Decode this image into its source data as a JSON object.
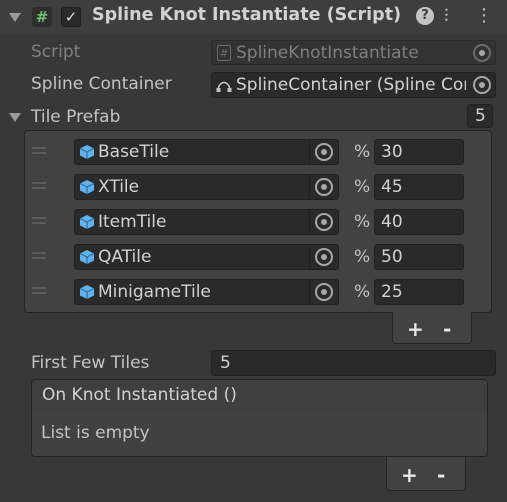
{
  "header": {
    "title": "Spline Knot Instantiate (Script)",
    "script_icon_glyph": "#",
    "enabled_glyph": "✓",
    "help_glyph": "?",
    "settings_glyph": "⫶",
    "menu_glyph": "⋮"
  },
  "script_row": {
    "label": "Script",
    "value": "SplineKnotInstantiate"
  },
  "container_row": {
    "label": "Spline Container",
    "value": "SplineContainer (Spline Con"
  },
  "tile_prefab": {
    "label": "Tile Prefab",
    "size": "5",
    "items": [
      {
        "name": "BaseTile",
        "percent_symbol": "%",
        "percent": "30"
      },
      {
        "name": "XTile",
        "percent_symbol": "%",
        "percent": "45"
      },
      {
        "name": "ItemTile",
        "percent_symbol": "%",
        "percent": "40"
      },
      {
        "name": "QATile",
        "percent_symbol": "%",
        "percent": "50"
      },
      {
        "name": "MinigameTile",
        "percent_symbol": "%",
        "percent": "25"
      }
    ],
    "add_label": "+",
    "remove_label": "-"
  },
  "first_few_tiles": {
    "label": "First Few Tiles",
    "value": "5"
  },
  "event": {
    "title": "On Knot Instantiated ()",
    "empty_text": "List is empty",
    "add_label": "+",
    "remove_label": "-"
  },
  "colors": {
    "background": "#383838",
    "field": "#2a2a2a",
    "script_icon": "#6ec06e",
    "prefab_icon": "#5fb4f0"
  }
}
